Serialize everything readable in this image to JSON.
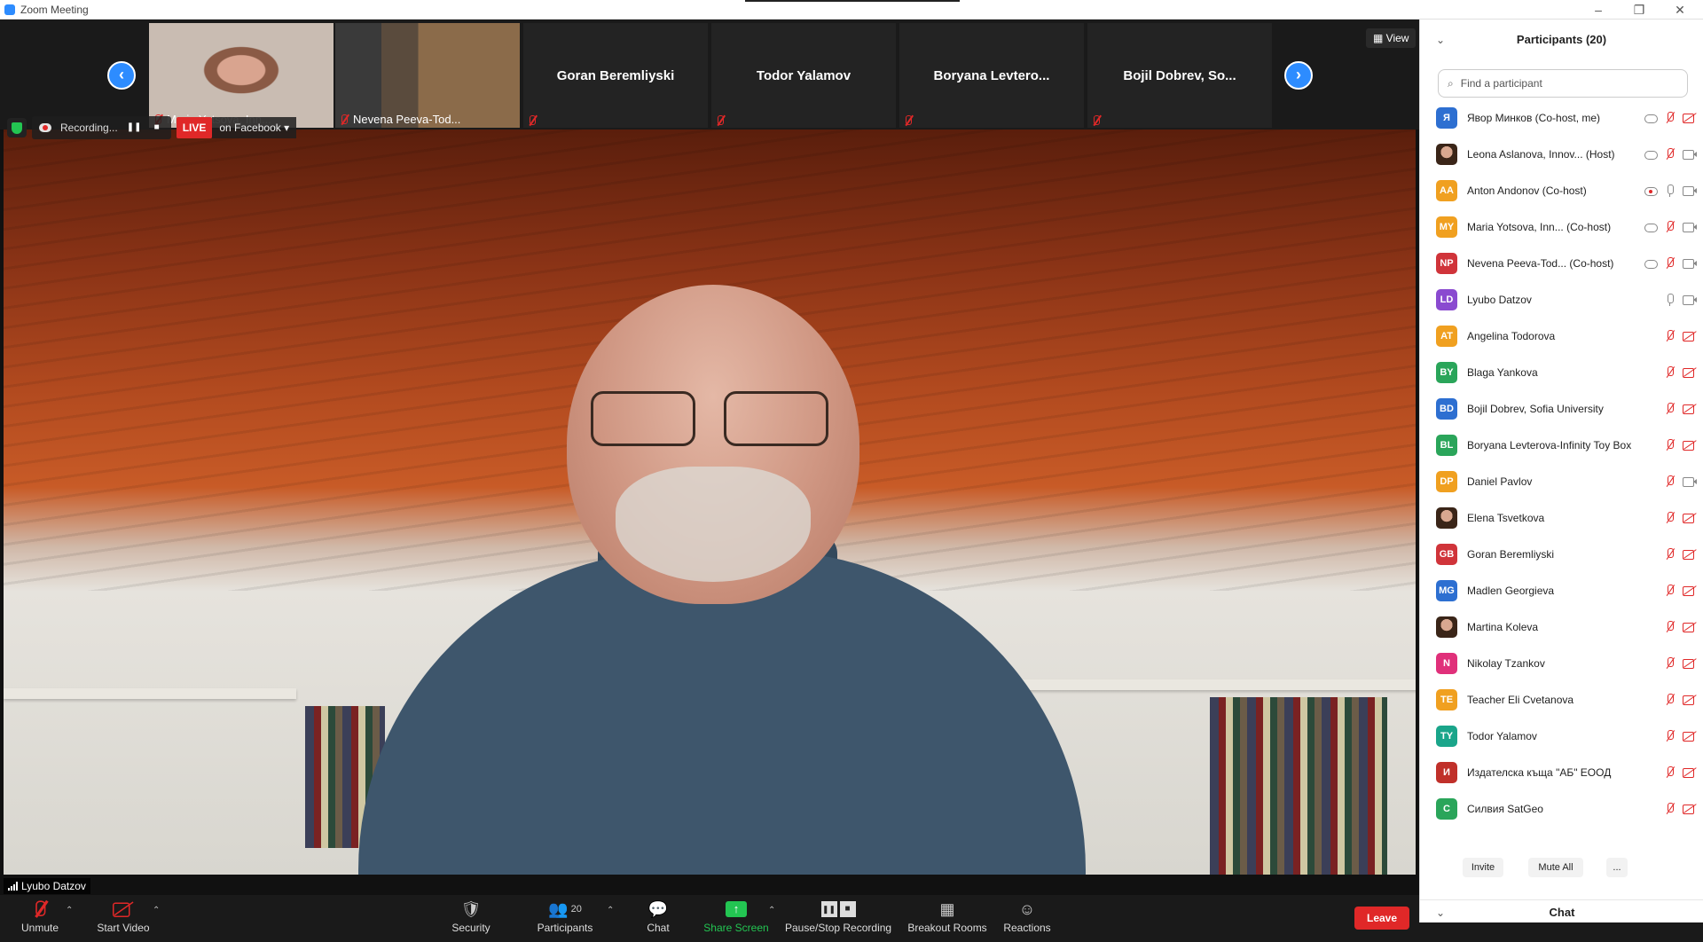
{
  "window": {
    "title": "Zoom Meeting",
    "minimize": "–",
    "restore": "❐",
    "close": "✕"
  },
  "strip": {
    "prev": "‹",
    "next": "›",
    "view_label": "View",
    "tiles": [
      {
        "name": "Maria Yotsova, Inn...",
        "type": "video"
      },
      {
        "name": "Nevena Peeva-Tod...",
        "type": "video"
      },
      {
        "name": "Goran Beremliyski",
        "type": "name"
      },
      {
        "name": "Todor Yalamov",
        "type": "name"
      },
      {
        "name": "Boryana  Levtero...",
        "type": "name"
      },
      {
        "name": "Bojil Dobrev, So...",
        "type": "name"
      }
    ]
  },
  "recording": {
    "status": "Recording...",
    "pause": "❚❚",
    "stop": "■",
    "live": "LIVE",
    "destination": "on Facebook ▾"
  },
  "speaker": {
    "name": "Lyubo Datzov"
  },
  "toolbar": {
    "unmute": "Unmute",
    "start_video": "Start Video",
    "security": "Security",
    "participants": "Participants",
    "participants_count": "20",
    "chat": "Chat",
    "share_screen": "Share Screen",
    "pause_stop_recording": "Pause/Stop Recording",
    "breakout_rooms": "Breakout Rooms",
    "reactions": "Reactions",
    "leave": "Leave",
    "caret": "⌃"
  },
  "panel": {
    "title": "Participants (20)",
    "collapse": "⌄",
    "search_placeholder": "Find a participant",
    "participants": [
      {
        "initials": "Я",
        "color": "#2d6fd1",
        "name": "Явор Минков (Co-host, me)",
        "rec": "cloud",
        "mic": "off",
        "video": "off"
      },
      {
        "initials": "",
        "color": "#7b4d3a",
        "photo": true,
        "name": "Leona Aslanova, Innov...  (Host)",
        "rec": "cloud",
        "mic": "off",
        "video": "on"
      },
      {
        "initials": "AA",
        "color": "#f0a020",
        "name": "Anton Andonov (Co-host)",
        "rec": "cloudred",
        "mic": "on",
        "video": "on"
      },
      {
        "initials": "MY",
        "color": "#f0a020",
        "name": "Maria Yotsova, Inn...  (Co-host)",
        "rec": "cloud",
        "mic": "off",
        "video": "on"
      },
      {
        "initials": "NP",
        "color": "#d0343a",
        "name": "Nevena Peeva-Tod...  (Co-host)",
        "rec": "cloud",
        "mic": "off",
        "video": "on"
      },
      {
        "initials": "LD",
        "color": "#8a4ad0",
        "name": "Lyubo Datzov",
        "rec": "",
        "mic": "on",
        "video": "on"
      },
      {
        "initials": "AT",
        "color": "#f0a020",
        "name": "Angelina Todorova",
        "rec": "",
        "mic": "off",
        "video": "off"
      },
      {
        "initials": "BY",
        "color": "#2aa55a",
        "name": "Blaga Yankova",
        "rec": "",
        "mic": "off",
        "video": "off"
      },
      {
        "initials": "BD",
        "color": "#2d6fd1",
        "name": "Bojil Dobrev, Sofia University",
        "rec": "",
        "mic": "off",
        "video": "off"
      },
      {
        "initials": "BL",
        "color": "#2aa55a",
        "name": "Boryana Levterova-Infinity Toy Box",
        "rec": "",
        "mic": "off",
        "video": "off"
      },
      {
        "initials": "DP",
        "color": "#f0a020",
        "name": "Daniel Pavlov",
        "rec": "",
        "mic": "off",
        "video": "on"
      },
      {
        "initials": "",
        "color": "#6a3a2a",
        "photo": true,
        "name": "Elena Tsvetkova",
        "rec": "",
        "mic": "off",
        "video": "off"
      },
      {
        "initials": "GB",
        "color": "#d0343a",
        "name": "Goran Beremliyski",
        "rec": "",
        "mic": "off",
        "video": "off"
      },
      {
        "initials": "MG",
        "color": "#2d6fd1",
        "name": "Madlen Georgieva",
        "rec": "",
        "mic": "off",
        "video": "off"
      },
      {
        "initials": "",
        "color": "#c98870",
        "photo": true,
        "name": "Martina Koleva",
        "rec": "",
        "mic": "off",
        "video": "off"
      },
      {
        "initials": "N",
        "color": "#e0307a",
        "name": "Nikolay Tzankov",
        "rec": "",
        "mic": "off",
        "video": "off"
      },
      {
        "initials": "TE",
        "color": "#f0a020",
        "name": "Teacher Eli Cvetanova",
        "rec": "",
        "mic": "off",
        "video": "off"
      },
      {
        "initials": "TY",
        "color": "#1aa58a",
        "name": "Todor Yalamov",
        "rec": "",
        "mic": "off",
        "video": "off"
      },
      {
        "initials": "И",
        "color": "#c0302a",
        "name": "Издателска къща \"АБ\" ЕООД",
        "rec": "",
        "mic": "off",
        "video": "off"
      },
      {
        "initials": "С",
        "color": "#2aa55a",
        "name": "Силвия SatGeo",
        "rec": "",
        "mic": "off",
        "video": "off"
      }
    ],
    "invite": "Invite",
    "mute_all": "Mute All",
    "more": "...",
    "chat_title": "Chat"
  }
}
